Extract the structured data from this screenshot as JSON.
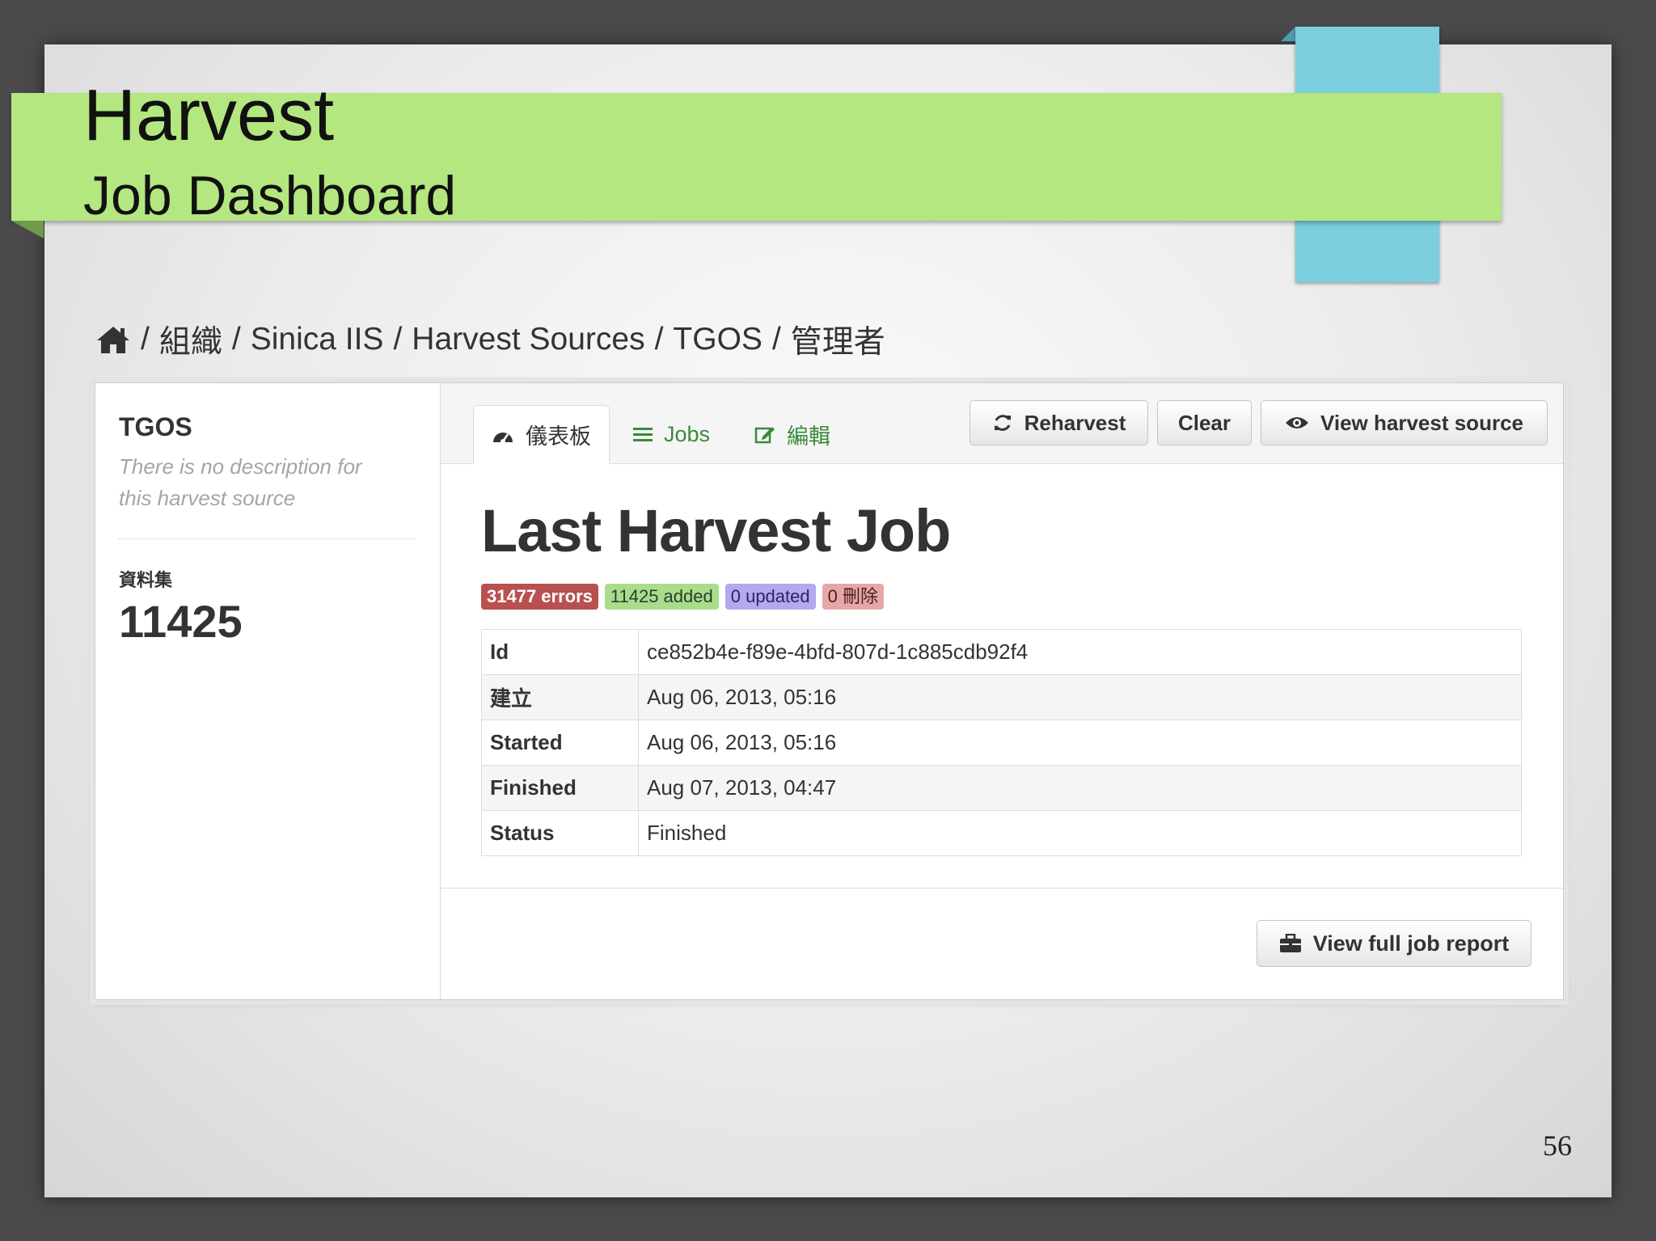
{
  "slide": {
    "title": "Harvest",
    "subtitle": "Job Dashboard",
    "page_number": "56"
  },
  "breadcrumb": {
    "items": [
      "組織",
      "Sinica IIS",
      "Harvest Sources",
      "TGOS",
      "管理者"
    ],
    "separator": "/",
    "home_icon": "home-icon"
  },
  "sidebar": {
    "title": "TGOS",
    "description": "There is no description for this harvest source",
    "datasets_label": "資料集",
    "datasets_count": "11425"
  },
  "tabs": [
    {
      "label": "儀表板",
      "icon": "dashboard-icon",
      "active": true
    },
    {
      "label": "Jobs",
      "icon": "list-icon",
      "active": false
    },
    {
      "label": "編輯",
      "icon": "edit-icon",
      "active": false
    }
  ],
  "actions": {
    "reharvest": "Reharvest",
    "clear": "Clear",
    "view_source": "View harvest source",
    "view_report": "View full job report"
  },
  "job": {
    "heading": "Last Harvest Job",
    "badges": {
      "errors": "31477 errors",
      "added": "11425 added",
      "updated": "0 updated",
      "deleted": "0 刪除"
    },
    "rows": [
      {
        "key": "Id",
        "value": "ce852b4e-f89e-4bfd-807d-1c885cdb92f4"
      },
      {
        "key": "建立",
        "value": "Aug 06, 2013, 05:16"
      },
      {
        "key": "Started",
        "value": "Aug 06, 2013, 05:16"
      },
      {
        "key": "Finished",
        "value": "Aug 07, 2013, 04:47"
      },
      {
        "key": "Status",
        "value": "Finished"
      }
    ]
  },
  "colors": {
    "banner_green": "#b4e780",
    "tab_blue": "#7ccfdf",
    "errors_badge": "#b95050",
    "added_badge": "#a9dd8c",
    "updated_badge": "#b4a8ef",
    "deleted_badge": "#e8a7a7",
    "link_green": "#3a8a3a"
  }
}
